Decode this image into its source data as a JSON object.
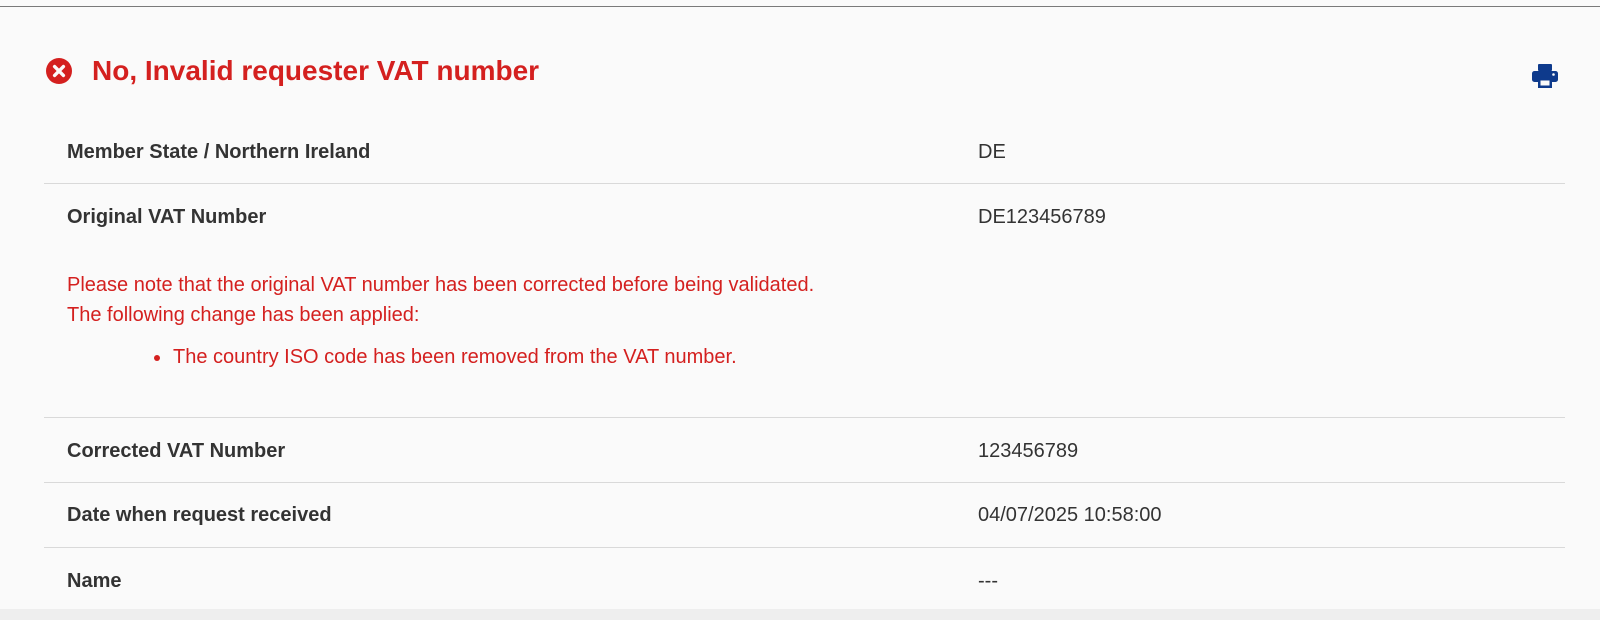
{
  "colors": {
    "error": "#d4201f",
    "text": "#333333",
    "print_icon": "#0e3a8c",
    "divider": "#d9d9d9",
    "panel_background": "#fafafa"
  },
  "result": {
    "status_icon": "error-circle-x-icon",
    "title": "No, Invalid requester VAT number",
    "print_icon": "print-icon"
  },
  "details": {
    "member_state": {
      "label": "Member State / Northern Ireland",
      "value": "DE"
    },
    "original_vat": {
      "label": "Original VAT Number",
      "value": "DE123456789"
    },
    "correction_notice": {
      "line1": "Please note that the original VAT number has been corrected before being validated.",
      "line2": "The following change has been applied:",
      "changes": [
        "The country ISO code has been removed from the VAT number."
      ]
    },
    "corrected_vat": {
      "label": "Corrected VAT Number",
      "value": "123456789"
    },
    "request_date": {
      "label": "Date when request received",
      "value": "04/07/2025 10:58:00"
    },
    "name": {
      "label": "Name",
      "value": "---"
    }
  }
}
